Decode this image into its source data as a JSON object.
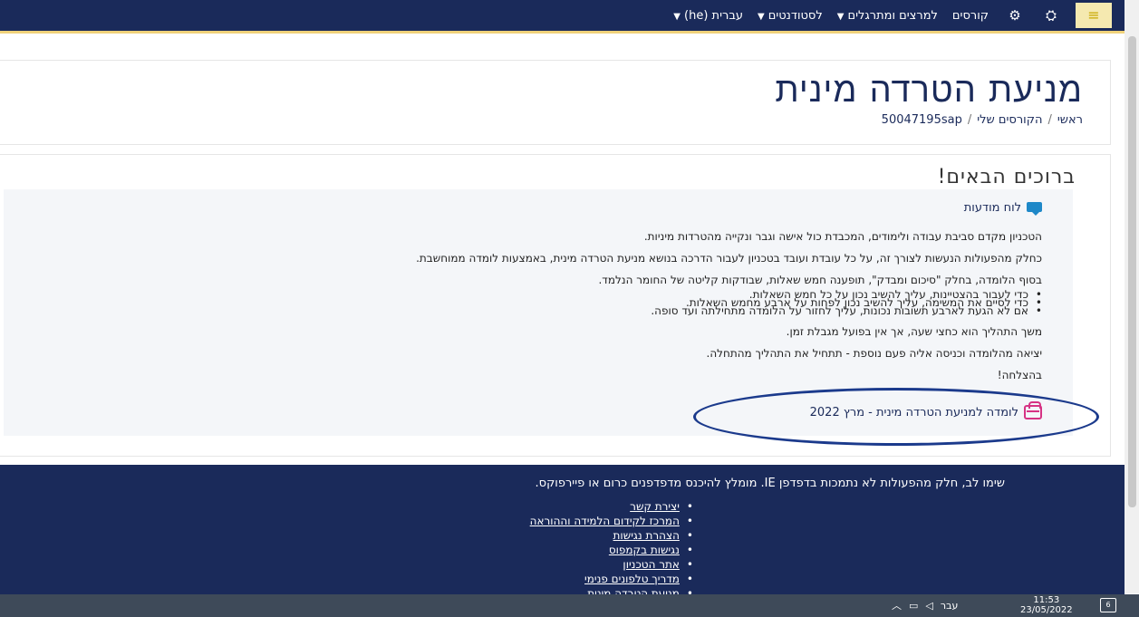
{
  "topbar": {
    "language": "עברית (he)",
    "students": "לסטודנטים",
    "lecturers": "למרצים ומתרגלים",
    "courses": "קורסים",
    "icons": [
      "menu-icon",
      "accessibility-icon",
      "gears-icon"
    ]
  },
  "header": {
    "title": "מניעת הטרדה מינית",
    "breadcrumb": [
      "ראשי",
      "הקורסים שלי",
      "50047195sap"
    ]
  },
  "main": {
    "welcome": "ברוכים הבאים!",
    "forum_link": "לוח מודעות",
    "paragraphs": [
      "הטכניון מקדם סביבת עבודה ולימודים, המכבדת כול אישה וגבר ונקייה מהטרדות מיניות.",
      "כחלק מהפעולות הנעשות לצורך זה, על כל עובדת ועובד בטכניון לעבור הדרכה בנושא מניעת הטרדה מינית, באמצעות לומדה ממוחשבת.",
      "בסוף הלומדה, בחלק \"סיכום ומבדק\", תופענה חמש שאלות, שבודקות קליטה של החומר הנלמד."
    ],
    "bullets": [
      "כדי לעבור בהצטיינות, עליך להשיב נכון על כל חמש השאלות.",
      "כדי לסיים את המשימה, עליך להשיב נכון לפחות על ארבע מחמש השאלות.",
      "אם לא הגעת לארבע תשובות נכונות, עליך לחזור על הלומדה מתחילתה ועד סופה."
    ],
    "after": [
      "משך התהליך הוא כחצי שעה, אך אין בפועל מגבלת זמן.",
      "יציאה מהלומדה וכניסה אליה פעם נוספת - תתחיל את התהליך מהתחלה.",
      "בהצלחה!"
    ],
    "quiz_link": "לומדה למניעת הטרדה מינית - מרץ 2022"
  },
  "footer": {
    "note": "שימו לב, חלק מהפעולות לא נתמכות בדפדפן IE. מומלץ להיכנס מדפדפנים כרום או פיירפוקס.",
    "links": [
      "יצירת קשר",
      "המרכז לקידום הלמידה וההוראה",
      "הצהרת נגישות",
      "נגישות בקמפוס",
      "אתר הטכניון",
      "מדריך טלפונים פנימי",
      "מניעת הטרדה מינית"
    ]
  },
  "taskbar": {
    "lang": "עבר",
    "time": "11:53",
    "date": "23/05/2022",
    "notifications": "6"
  },
  "colors": {
    "navy": "#1a2a5a",
    "gold": "#f0d27a",
    "link_icon_blue": "#1e88c8",
    "quiz_icon_pink": "#d63384"
  }
}
